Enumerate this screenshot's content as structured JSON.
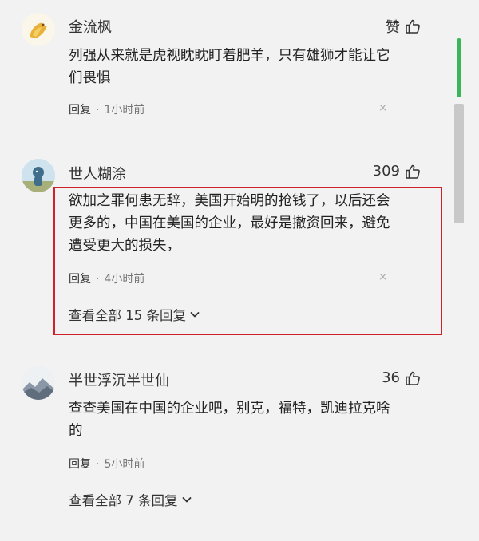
{
  "comments": [
    {
      "username": "金流枫",
      "likes": "赞",
      "text_lines": [
        "列强从来就是虎视眈眈盯着肥羊，只有雄狮才能让它",
        "们畏惧"
      ],
      "reply_label": "回复",
      "separator": "·",
      "time": "1小时前",
      "close_glyph": "×",
      "avatar_icon": "golden-bird-avatar"
    },
    {
      "username": "世人糊涂",
      "likes": "309",
      "text_lines": [
        "欲加之罪何患无辞，美国开始明的抢钱了，以后还会",
        "更多的，中国在美国的企业，最好是撤资回来，避免",
        "遭受更大的损失，"
      ],
      "reply_label": "回复",
      "separator": "·",
      "time": "4小时前",
      "close_glyph": "×",
      "view_all": "查看全部 15 条回复",
      "avatar_icon": "sky-figure-avatar"
    },
    {
      "username": "半世浮沉半世仙",
      "likes": "36",
      "text_lines": [
        "查查美国在中国的企业吧，别克，福特，凯迪拉克啥",
        "的"
      ],
      "reply_label": "回复",
      "separator": "·",
      "time": "5小时前",
      "view_all": "查看全部 7 条回复",
      "avatar_icon": "mountain-landscape-avatar"
    }
  ],
  "colors": {
    "background": "#f2f2f2",
    "highlight_border": "#d0222a",
    "scrollbar_accent": "#3bb55a"
  }
}
